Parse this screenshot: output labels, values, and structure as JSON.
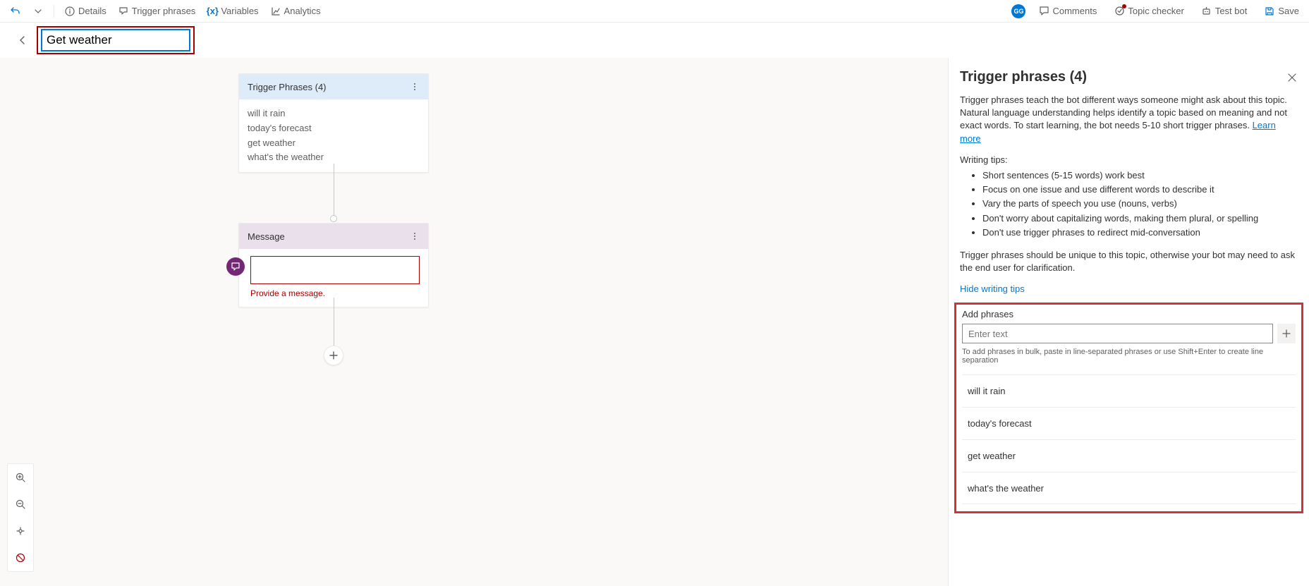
{
  "toolbar": {
    "details": "Details",
    "trigger_phrases": "Trigger phrases",
    "variables": "Variables",
    "analytics": "Analytics",
    "avatar": "GG",
    "comments": "Comments",
    "topic_checker": "Topic checker",
    "test_bot": "Test bot",
    "save": "Save"
  },
  "title": {
    "value": "Get weather"
  },
  "canvas": {
    "trigger_node": {
      "header": "Trigger Phrases (4)",
      "phrases": [
        "will it rain",
        "today's forecast",
        "get weather",
        "what's the weather"
      ]
    },
    "message_node": {
      "header": "Message",
      "error": "Provide a message."
    }
  },
  "side_panel": {
    "title": "Trigger phrases (4)",
    "description": "Trigger phrases teach the bot different ways someone might ask about this topic. Natural language understanding helps identify a topic based on meaning and not exact words. To start learning, the bot needs 5-10 short trigger phrases.",
    "learn_more": "Learn more",
    "tips_label": "Writing tips:",
    "tips": [
      "Short sentences (5-15 words) work best",
      "Focus on one issue and use different words to describe it",
      "Vary the parts of speech you use (nouns, verbs)",
      "Don't worry about capitalizing words, making them plural, or spelling",
      "Don't use trigger phrases to redirect mid-conversation"
    ],
    "unique_note": "Trigger phrases should be unique to this topic, otherwise your bot may need to ask the end user for clarification.",
    "hide_tips": "Hide writing tips",
    "add_label": "Add phrases",
    "add_placeholder": "Enter text",
    "add_hint": "To add phrases in bulk, paste in line-separated phrases or use Shift+Enter to create line separation",
    "phrases": [
      "will it rain",
      "today's forecast",
      "get weather",
      "what's the weather"
    ]
  }
}
